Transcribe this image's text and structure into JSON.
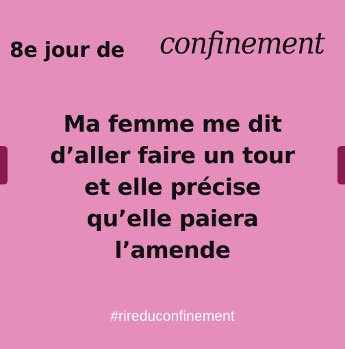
{
  "card": {
    "title_plain": "8e jour de",
    "title_script": "confinement",
    "joke_lines": [
      "Ma femme me dit",
      "d’aller faire un tour",
      "et elle précise",
      "qu’elle paiera",
      "l’amende"
    ],
    "hashtag": "#rireduconfinement"
  },
  "colors": {
    "background": "#e58dbb",
    "text": "#111111",
    "hashtag": "#ffffff",
    "edge_handles": "#8b1a4e"
  }
}
